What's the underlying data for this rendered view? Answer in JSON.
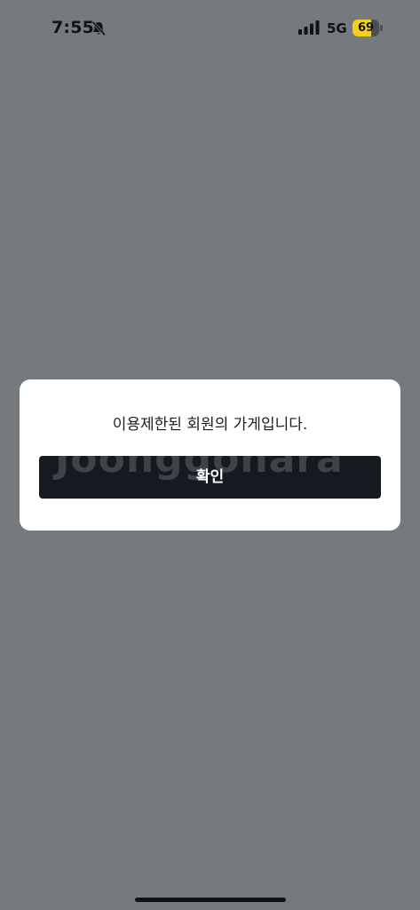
{
  "status_bar": {
    "time": "7:55",
    "network": "5G",
    "battery_level": "69",
    "battery_fraction": 0.69
  },
  "dialog": {
    "message": "이용제한된 회원의 가게입니다.",
    "confirm_label": "확인",
    "button_watermark": "Joonggonara"
  },
  "icons": {
    "bell": "bell-off-icon",
    "signal": "cellular-signal-icon",
    "battery": "battery-icon"
  },
  "colors": {
    "overlay": "#747a7e",
    "button": "#141a20",
    "battery_fill": "#f5d019"
  }
}
